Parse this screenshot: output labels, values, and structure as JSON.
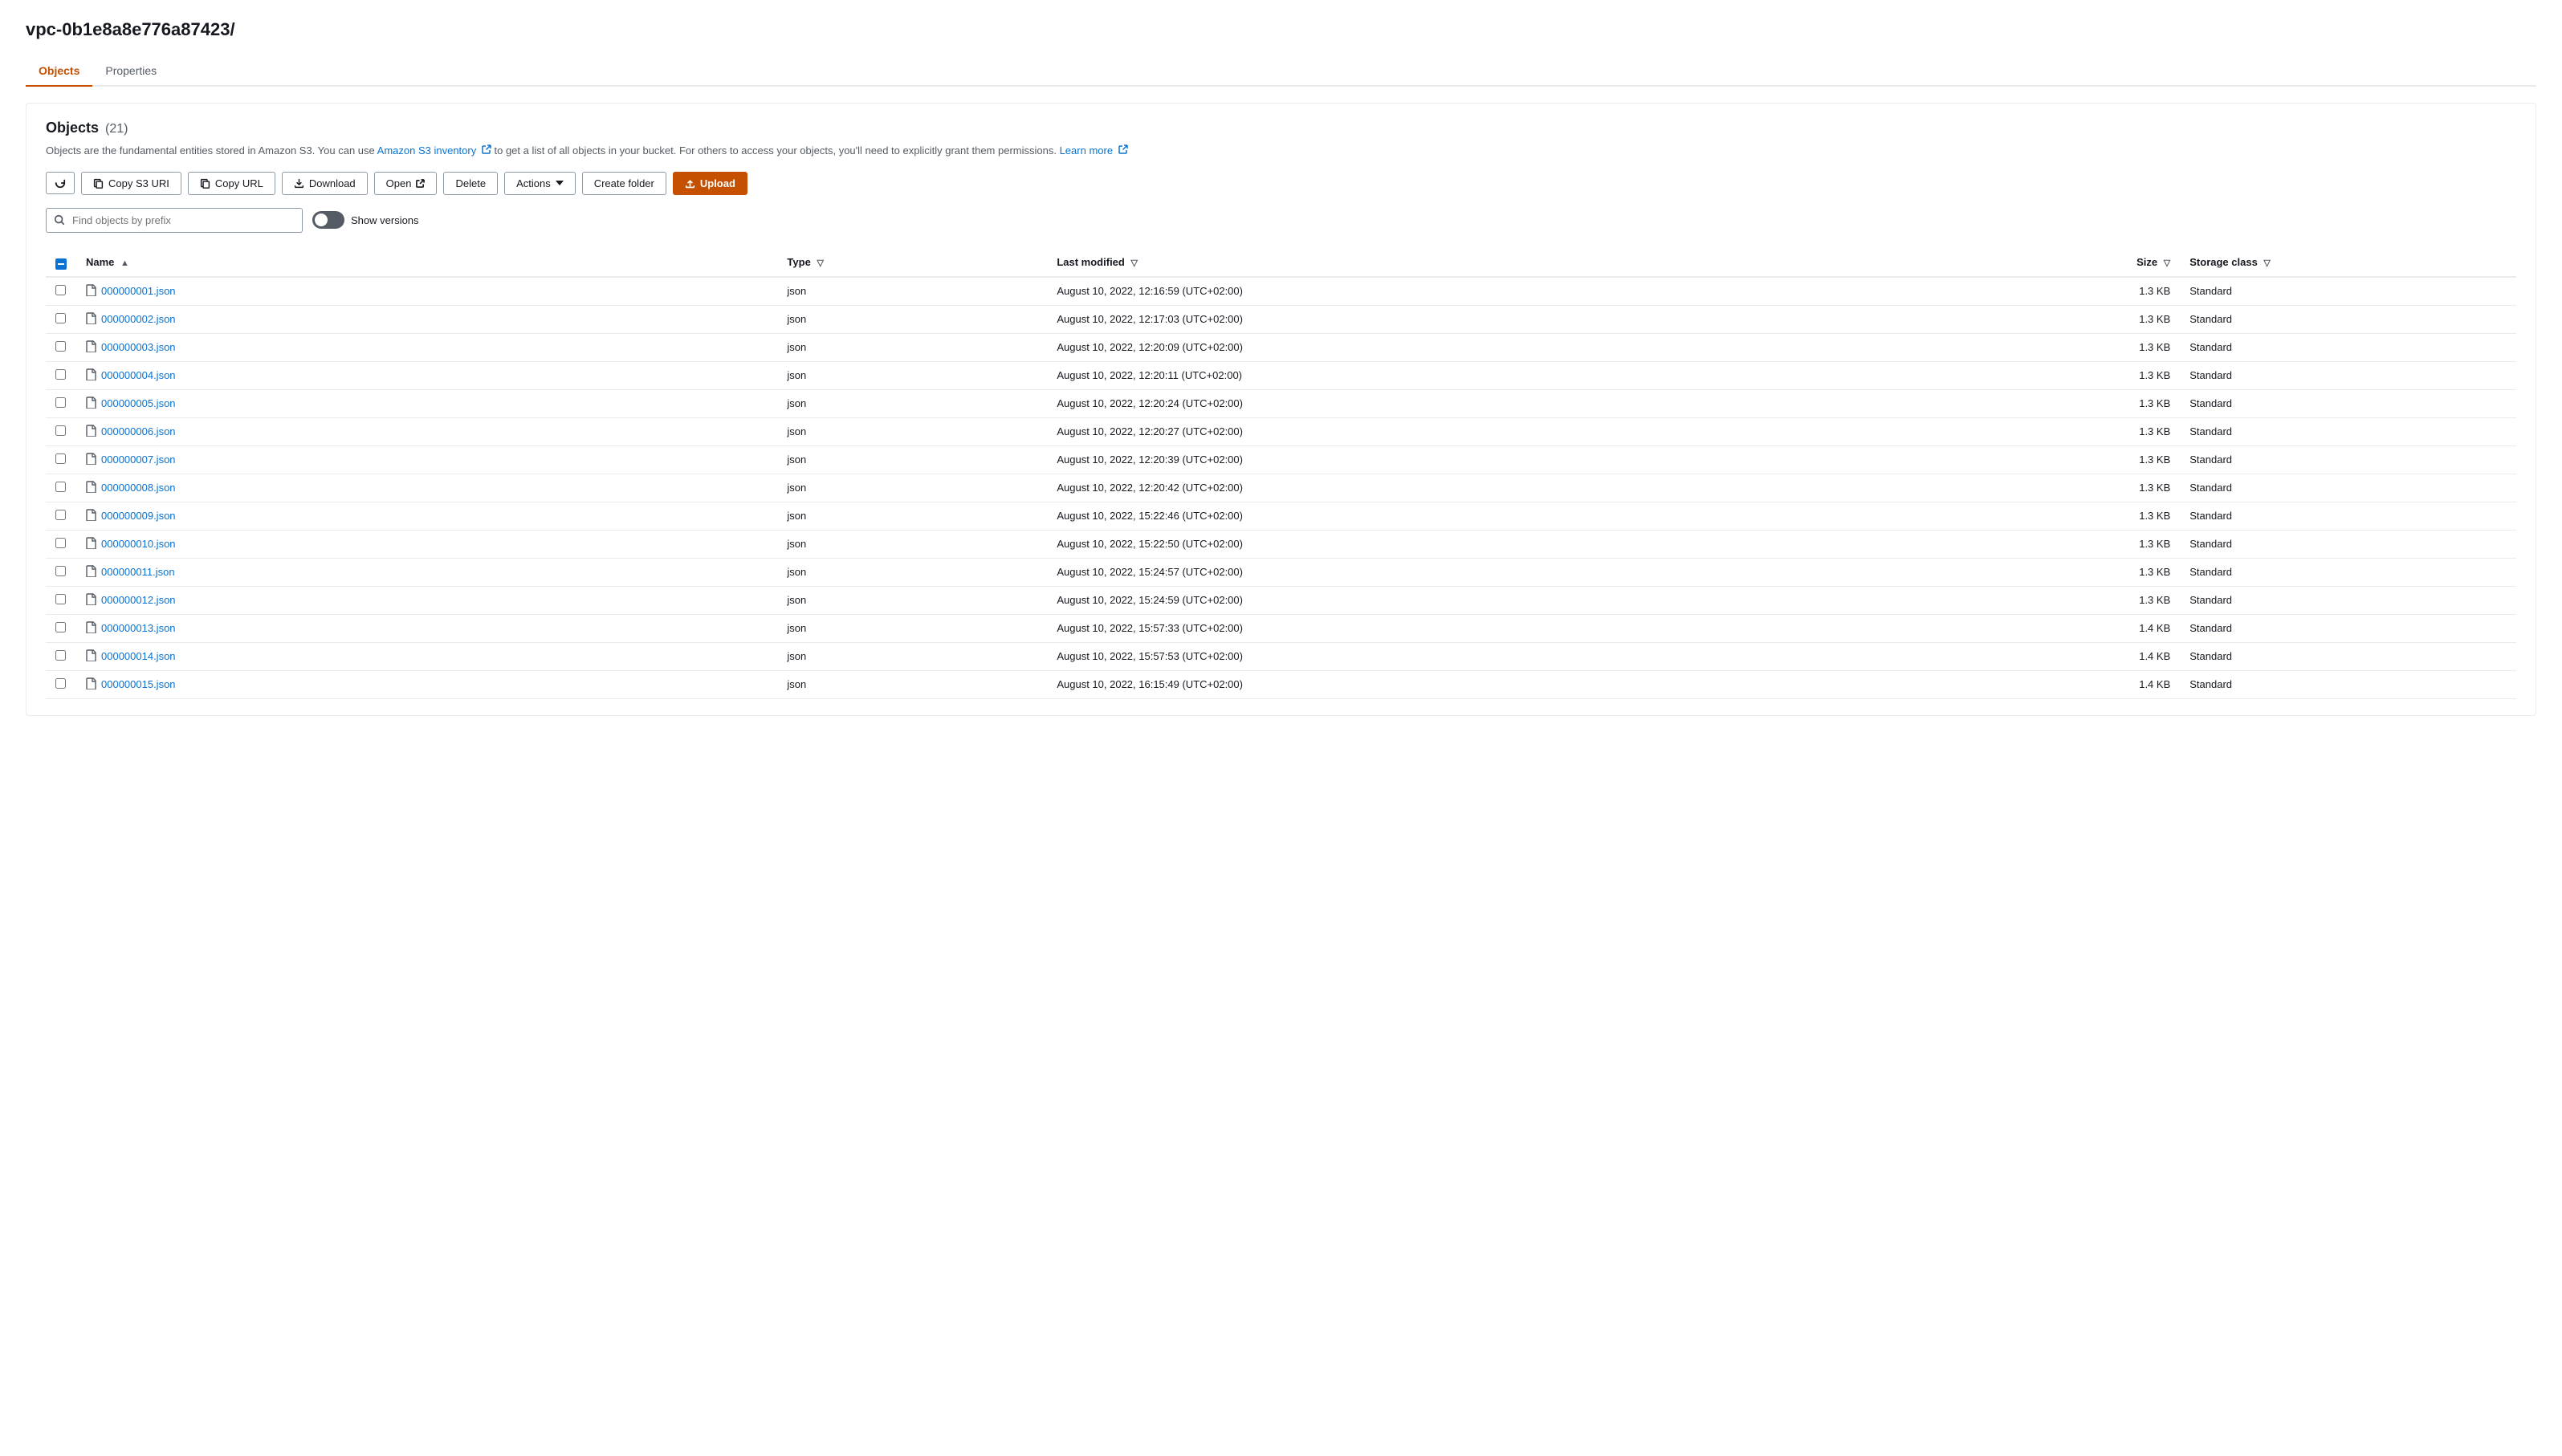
{
  "page": {
    "title": "vpc-0b1e8a8e776a87423/"
  },
  "tabs": [
    {
      "id": "objects",
      "label": "Objects",
      "active": true
    },
    {
      "id": "properties",
      "label": "Properties",
      "active": false
    }
  ],
  "section": {
    "title": "Objects",
    "count": "(21)",
    "info": "Objects are the fundamental entities stored in Amazon S3. You can use ",
    "inventory_link": "Amazon S3 inventory",
    "info2": " to get a list of all objects in your bucket. For others to access your objects, you'll need to explicitly grant them permissions. ",
    "learn_more": "Learn more"
  },
  "toolbar": {
    "refresh_label": "↺",
    "copy_s3_uri_label": "Copy S3 URI",
    "copy_url_label": "Copy URL",
    "download_label": "Download",
    "open_label": "Open",
    "delete_label": "Delete",
    "actions_label": "Actions",
    "create_folder_label": "Create folder",
    "upload_label": "Upload"
  },
  "search": {
    "placeholder": "Find objects by prefix"
  },
  "show_versions": {
    "label": "Show versions",
    "enabled": false
  },
  "table": {
    "columns": [
      {
        "id": "name",
        "label": "Name",
        "sortable": true
      },
      {
        "id": "type",
        "label": "Type",
        "sortable": true
      },
      {
        "id": "last_modified",
        "label": "Last modified",
        "sortable": true
      },
      {
        "id": "size",
        "label": "Size",
        "sortable": true
      },
      {
        "id": "storage_class",
        "label": "Storage class",
        "sortable": true
      }
    ],
    "rows": [
      {
        "name": "000000001.json",
        "type": "json",
        "last_modified": "August 10, 2022, 12:16:59 (UTC+02:00)",
        "size": "1.3 KB",
        "storage_class": "Standard"
      },
      {
        "name": "000000002.json",
        "type": "json",
        "last_modified": "August 10, 2022, 12:17:03 (UTC+02:00)",
        "size": "1.3 KB",
        "storage_class": "Standard"
      },
      {
        "name": "000000003.json",
        "type": "json",
        "last_modified": "August 10, 2022, 12:20:09 (UTC+02:00)",
        "size": "1.3 KB",
        "storage_class": "Standard"
      },
      {
        "name": "000000004.json",
        "type": "json",
        "last_modified": "August 10, 2022, 12:20:11 (UTC+02:00)",
        "size": "1.3 KB",
        "storage_class": "Standard"
      },
      {
        "name": "000000005.json",
        "type": "json",
        "last_modified": "August 10, 2022, 12:20:24 (UTC+02:00)",
        "size": "1.3 KB",
        "storage_class": "Standard"
      },
      {
        "name": "000000006.json",
        "type": "json",
        "last_modified": "August 10, 2022, 12:20:27 (UTC+02:00)",
        "size": "1.3 KB",
        "storage_class": "Standard"
      },
      {
        "name": "000000007.json",
        "type": "json",
        "last_modified": "August 10, 2022, 12:20:39 (UTC+02:00)",
        "size": "1.3 KB",
        "storage_class": "Standard"
      },
      {
        "name": "000000008.json",
        "type": "json",
        "last_modified": "August 10, 2022, 12:20:42 (UTC+02:00)",
        "size": "1.3 KB",
        "storage_class": "Standard"
      },
      {
        "name": "000000009.json",
        "type": "json",
        "last_modified": "August 10, 2022, 15:22:46 (UTC+02:00)",
        "size": "1.3 KB",
        "storage_class": "Standard"
      },
      {
        "name": "000000010.json",
        "type": "json",
        "last_modified": "August 10, 2022, 15:22:50 (UTC+02:00)",
        "size": "1.3 KB",
        "storage_class": "Standard"
      },
      {
        "name": "000000011.json",
        "type": "json",
        "last_modified": "August 10, 2022, 15:24:57 (UTC+02:00)",
        "size": "1.3 KB",
        "storage_class": "Standard"
      },
      {
        "name": "000000012.json",
        "type": "json",
        "last_modified": "August 10, 2022, 15:24:59 (UTC+02:00)",
        "size": "1.3 KB",
        "storage_class": "Standard"
      },
      {
        "name": "000000013.json",
        "type": "json",
        "last_modified": "August 10, 2022, 15:57:33 (UTC+02:00)",
        "size": "1.4 KB",
        "storage_class": "Standard"
      },
      {
        "name": "000000014.json",
        "type": "json",
        "last_modified": "August 10, 2022, 15:57:53 (UTC+02:00)",
        "size": "1.4 KB",
        "storage_class": "Standard"
      },
      {
        "name": "000000015.json",
        "type": "json",
        "last_modified": "August 10, 2022, 16:15:49 (UTC+02:00)",
        "size": "1.4 KB",
        "storage_class": "Standard"
      }
    ]
  }
}
